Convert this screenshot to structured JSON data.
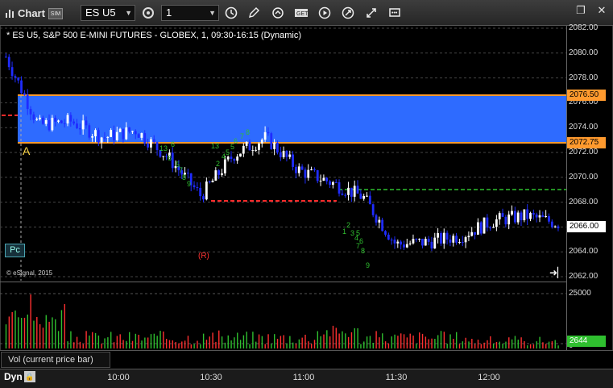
{
  "toolbar": {
    "app_title": "Chart",
    "app_badge": "SIM",
    "symbol": "ES U5",
    "interval": "1",
    "icons": [
      "link-settings-icon",
      "clock-icon",
      "pencil-icon",
      "refresh-icon",
      "get-icon",
      "play-icon",
      "arrows-icon",
      "more-icon"
    ]
  },
  "window": {
    "restore": "❐",
    "close": "✕"
  },
  "chart": {
    "header": "* ES U5, S&P 500 E-MINI FUTURES - GLOBEX, 1, 09:30-16:15 (Dynamic)",
    "copyright": "© eSignal, 2015",
    "pc_button": "Pc",
    "range_marker": "A",
    "r_label": "(R)",
    "price_labels": [
      "2082.00",
      "2080.00",
      "2078.00",
      "2076.00",
      "2074.00",
      "2072.00",
      "2070.00",
      "2068.00",
      "2066.00",
      "2064.00",
      "2062.00"
    ],
    "price_boxes": {
      "upper": "2076.50",
      "lower": "2072.75",
      "last": "2066.00"
    },
    "volume_labels": {
      "top": "25000",
      "bottom": "0",
      "last": "2644"
    },
    "volume_pane_label": "Vol (current price bar)",
    "time_labels": [
      "10:00",
      "10:30",
      "11:00",
      "11:30",
      "12:00"
    ],
    "dyn_label": "Dyn",
    "colors": {
      "band": "#2e6bff",
      "band_line": "#ff9a2e",
      "up": "#ffffff",
      "down": "#1f2cff",
      "red_line": "#ff2a2a",
      "green_line": "#2fbf2f",
      "last_box": "#2fbf2f"
    },
    "count_labels": [
      "13",
      "6",
      "6",
      "5",
      "7",
      "8",
      "9",
      "13",
      "2",
      "4",
      "5",
      "5",
      "6",
      "7",
      "8",
      "1",
      "2",
      "3",
      "4",
      "5",
      "6",
      "7",
      "8",
      "9"
    ]
  },
  "chart_data": {
    "type": "candlestick",
    "interval_minutes": 1,
    "y_range": [
      2061.5,
      2083
    ],
    "opening_range": {
      "high": 2076.5,
      "low": 2072.75
    },
    "last_price": 2066.0,
    "x": [
      "09:30",
      "09:45",
      "10:00",
      "10:15",
      "10:30",
      "10:45",
      "11:00",
      "11:15",
      "11:30",
      "11:45",
      "12:00",
      "12:15"
    ],
    "close_path": [
      2079.7,
      2074.2,
      2074.5,
      2073.2,
      2073.8,
      2071.6,
      2068.5,
      2071.8,
      2073.2,
      2070.6,
      2069.6,
      2068.4,
      2064.6,
      2064.8,
      2065.3,
      2066.5,
      2066.9,
      2066.3
    ],
    "volume_y_range": [
      0,
      25000
    ],
    "last_volume": 2644
  }
}
